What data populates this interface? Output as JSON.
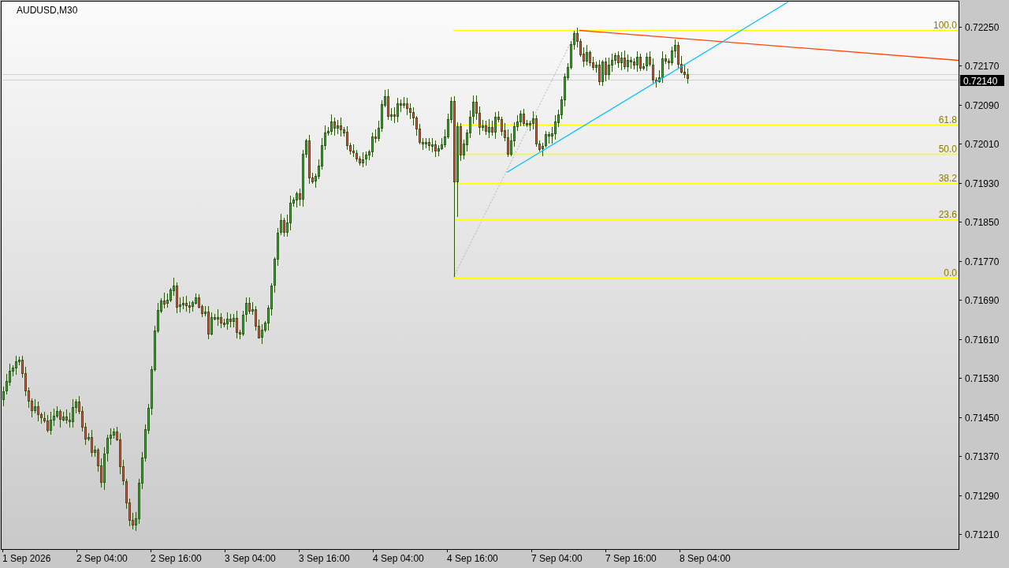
{
  "chart": {
    "symbol_title": "AUDUSD,M30",
    "price_axis": {
      "labels": [
        "0.72250",
        "0.72170",
        "0.72090",
        "0.72010",
        "0.71930",
        "0.71850",
        "0.71770",
        "0.71690",
        "0.71610",
        "0.71530",
        "0.71450",
        "0.71370",
        "0.71290",
        "0.71210"
      ]
    },
    "time_axis": {
      "labels": [
        "1 Sep 2026",
        "2 Sep 04:00",
        "2 Sep 16:00",
        "3 Sep 04:00",
        "3 Sep 16:00",
        "4 Sep 04:00",
        "4 Sep 16:00",
        "7 Sep 04:00",
        "7 Sep 16:00",
        "8 Sep 04:00"
      ]
    },
    "current_price": "0.72140",
    "fibonacci": {
      "levels": [
        {
          "label": "100.0"
        },
        {
          "label": "61.8"
        },
        {
          "label": "50.0"
        },
        {
          "label": "38.2"
        },
        {
          "label": "23.6"
        },
        {
          "label": "0.0"
        }
      ]
    },
    "trend_lines": [
      {
        "kind": "descending",
        "color": "#ff4500"
      },
      {
        "kind": "ascending",
        "color": "#00bfff"
      }
    ]
  }
}
